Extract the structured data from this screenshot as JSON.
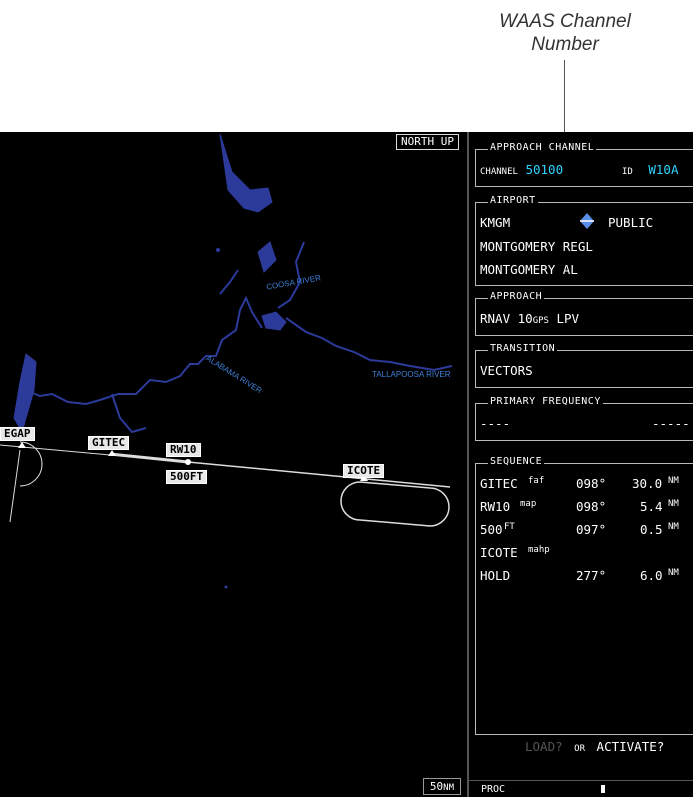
{
  "callout": {
    "line1": "WAAS Channel",
    "line2": "Number"
  },
  "map": {
    "orientation": "NORTH UP",
    "range": "50",
    "range_unit": "NM",
    "rivers": [
      "COOSA RIVER",
      "ALABAMA RIVER",
      "TALLAPOOSA RIVER"
    ],
    "waypoints": {
      "egap": "EGAP",
      "gitec": "GITEC",
      "rw10": "RW10",
      "alt": "500FT",
      "icote": "ICOTE"
    }
  },
  "panel": {
    "approach_channel": {
      "title": "APPROACH CHANNEL",
      "channel_label": "CHANNEL",
      "channel_value": "50100",
      "id_label": "ID",
      "id_value": "W10A"
    },
    "airport": {
      "title": "AIRPORT",
      "ident": "KMGM",
      "type": "PUBLIC",
      "name": "MONTGOMERY REGL",
      "city": "MONTGOMERY AL"
    },
    "approach": {
      "title": "APPROACH",
      "prefix": "RNAV 10",
      "gps": "GPS",
      "suffix": " LPV"
    },
    "transition": {
      "title": "TRANSITION",
      "value": "VECTORS"
    },
    "primary_frequency": {
      "title": "PRIMARY FREQUENCY",
      "left": "----",
      "right": "-----"
    },
    "sequence": {
      "title": "SEQUENCE",
      "rows": [
        {
          "fix": "GITEC",
          "tag": "faf",
          "crs": "098°",
          "dist": "30.0",
          "unit": "NM"
        },
        {
          "fix": "RW10",
          "tag": "map",
          "crs": "098°",
          "dist": "5.4",
          "unit": "NM"
        },
        {
          "fix": "500",
          "tag": "FT",
          "crs": "097°",
          "dist": "0.5",
          "unit": "NM"
        },
        {
          "fix": "ICOTE",
          "tag": "mahp",
          "crs": "",
          "dist": "",
          "unit": ""
        },
        {
          "fix": "HOLD",
          "tag": "",
          "crs": "277°",
          "dist": "6.0",
          "unit": "NM"
        }
      ]
    },
    "actions": {
      "load": "LOAD?",
      "or": "OR",
      "activate": "ACTIVATE?"
    },
    "softkey": "PROC"
  }
}
